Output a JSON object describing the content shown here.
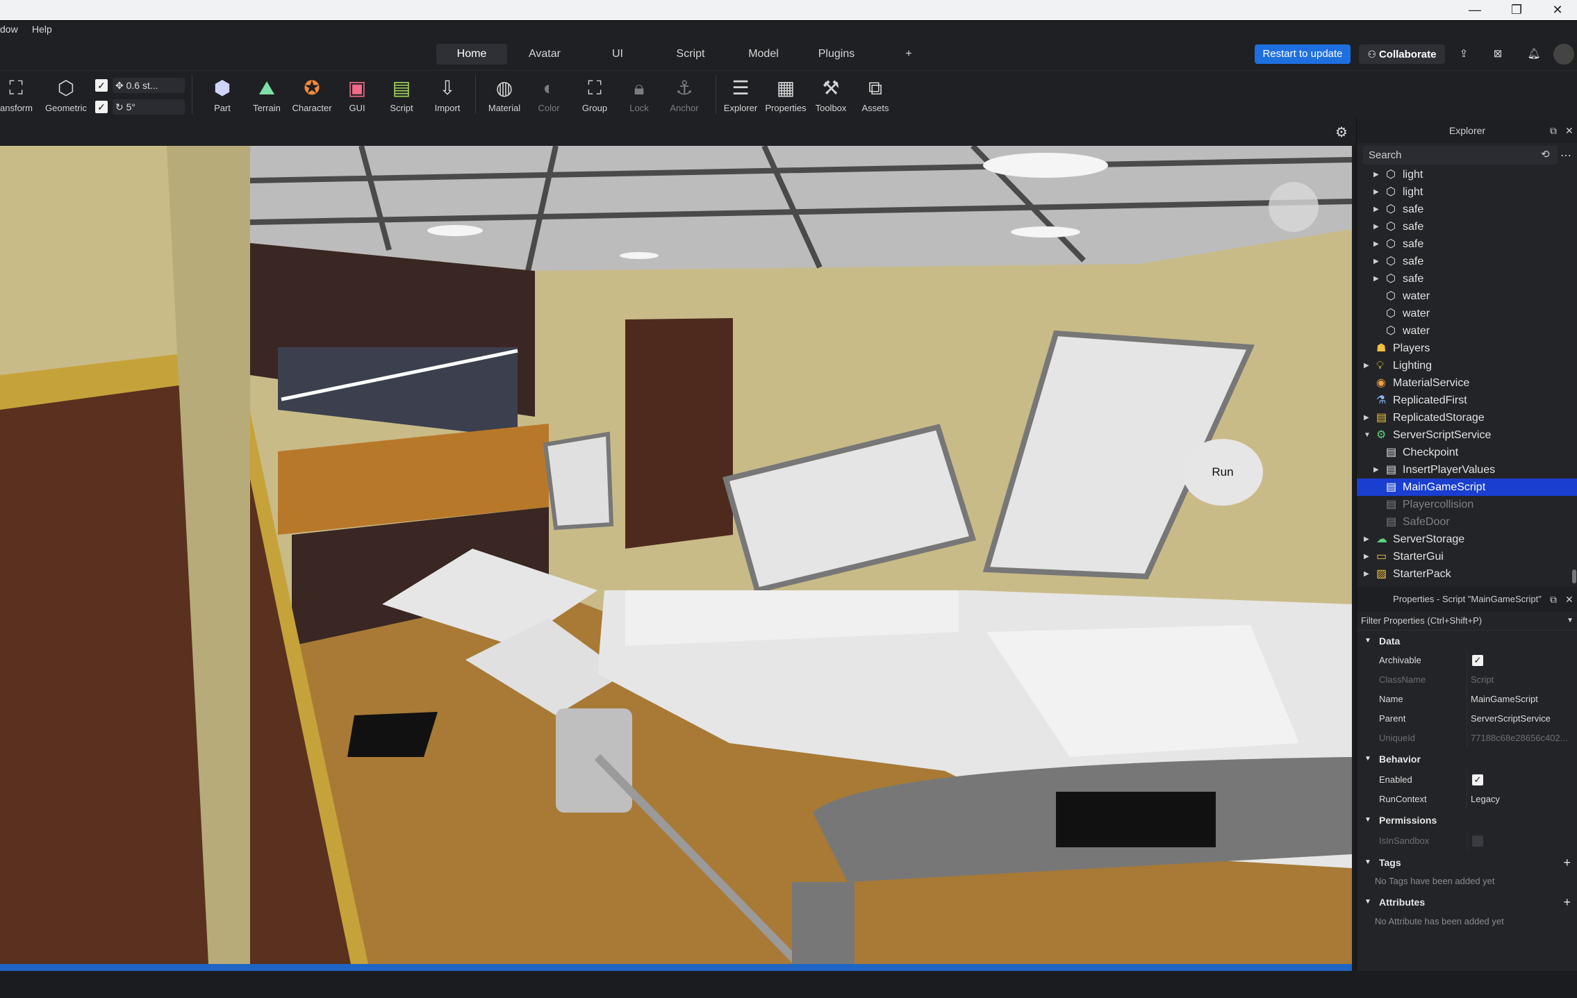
{
  "window": {
    "minimize": "—",
    "restore": "❐",
    "close": "✕"
  },
  "menu": [
    "dow",
    "Help"
  ],
  "tabs": [
    {
      "label": "Home",
      "active": true
    },
    {
      "label": "Avatar",
      "active": false
    },
    {
      "label": "UI",
      "active": false
    },
    {
      "label": "Script",
      "active": false
    },
    {
      "label": "Model",
      "active": false
    },
    {
      "label": "Plugins",
      "active": false
    },
    {
      "label": "+",
      "active": false
    }
  ],
  "top_actions": {
    "restart_label": "Restart to update",
    "collaborate_label": "Collaborate"
  },
  "ribbon": {
    "transform": "ansform",
    "geometric": "Geometric",
    "move_step": "0.6 st...",
    "rotate_step": "5°",
    "part": "Part",
    "terrain": "Terrain",
    "character": "Character",
    "gui": "GUI",
    "script": "Script",
    "import": "Import",
    "material": "Material",
    "color": "Color",
    "group": "Group",
    "lock": "Lock",
    "anchor": "Anchor",
    "explorer": "Explorer",
    "properties": "Properties",
    "toolbox": "Toolbox",
    "assets": "Assets"
  },
  "viewport": {
    "run_label": "Run"
  },
  "explorer": {
    "title": "Explorer",
    "search_placeholder": "Search",
    "items": [
      {
        "label": "light",
        "icon": "model-icon"
      },
      {
        "label": "light",
        "icon": "model-icon"
      },
      {
        "label": "safe",
        "icon": "model-icon"
      },
      {
        "label": "safe",
        "icon": "model-icon"
      },
      {
        "label": "safe",
        "icon": "model-icon"
      },
      {
        "label": "safe",
        "icon": "model-icon"
      },
      {
        "label": "safe",
        "icon": "model-icon"
      },
      {
        "label": "water",
        "icon": "model-icon"
      },
      {
        "label": "water",
        "icon": "model-icon"
      },
      {
        "label": "water",
        "icon": "model-icon"
      },
      {
        "label": "Players",
        "icon": "players-icon"
      },
      {
        "label": "Lighting",
        "icon": "lighting-icon"
      },
      {
        "label": "MaterialService",
        "icon": "material-service-icon"
      },
      {
        "label": "ReplicatedFirst",
        "icon": "replicated-first-icon"
      },
      {
        "label": "ReplicatedStorage",
        "icon": "replicated-storage-icon"
      },
      {
        "label": "ServerScriptService",
        "icon": "server-script-service-icon"
      },
      {
        "label": "Checkpoint",
        "icon": "script-icon"
      },
      {
        "label": "InsertPlayerValues",
        "icon": "script-icon"
      },
      {
        "label": "MainGameScript",
        "icon": "script-icon"
      },
      {
        "label": "Playercollision",
        "icon": "script-icon"
      },
      {
        "label": "SafeDoor",
        "icon": "script-icon"
      },
      {
        "label": "ServerStorage",
        "icon": "server-storage-icon"
      },
      {
        "label": "StarterGui",
        "icon": "starter-gui-icon"
      },
      {
        "label": "StarterPack",
        "icon": "starter-pack-icon"
      }
    ]
  },
  "properties": {
    "title": "Properties - Script \"MainGameScript\"",
    "filter_placeholder": "Filter Properties (Ctrl+Shift+P)",
    "sections": {
      "data": "Data",
      "behavior": "Behavior",
      "permissions": "Permissions",
      "tags": "Tags",
      "attributes": "Attributes"
    },
    "rows": {
      "archivable": "Archivable",
      "classname_key": "ClassName",
      "classname_val": "Script",
      "name_key": "Name",
      "name_val": "MainGameScript",
      "parent_key": "Parent",
      "parent_val": "ServerScriptService",
      "uniqueid_key": "UniqueId",
      "uniqueid_val": "77188c68e28656c402...",
      "enabled": "Enabled",
      "runcontext_key": "RunContext",
      "runcontext_val": "Legacy",
      "isinsandbox": "IsInSandbox"
    },
    "tags_note": "No Tags have been added yet",
    "attributes_note": "No Attribute has been added yet"
  },
  "colors": {
    "accent": "#1f65c4",
    "selection": "#1a3fd0",
    "restart": "#1e6fe0"
  }
}
